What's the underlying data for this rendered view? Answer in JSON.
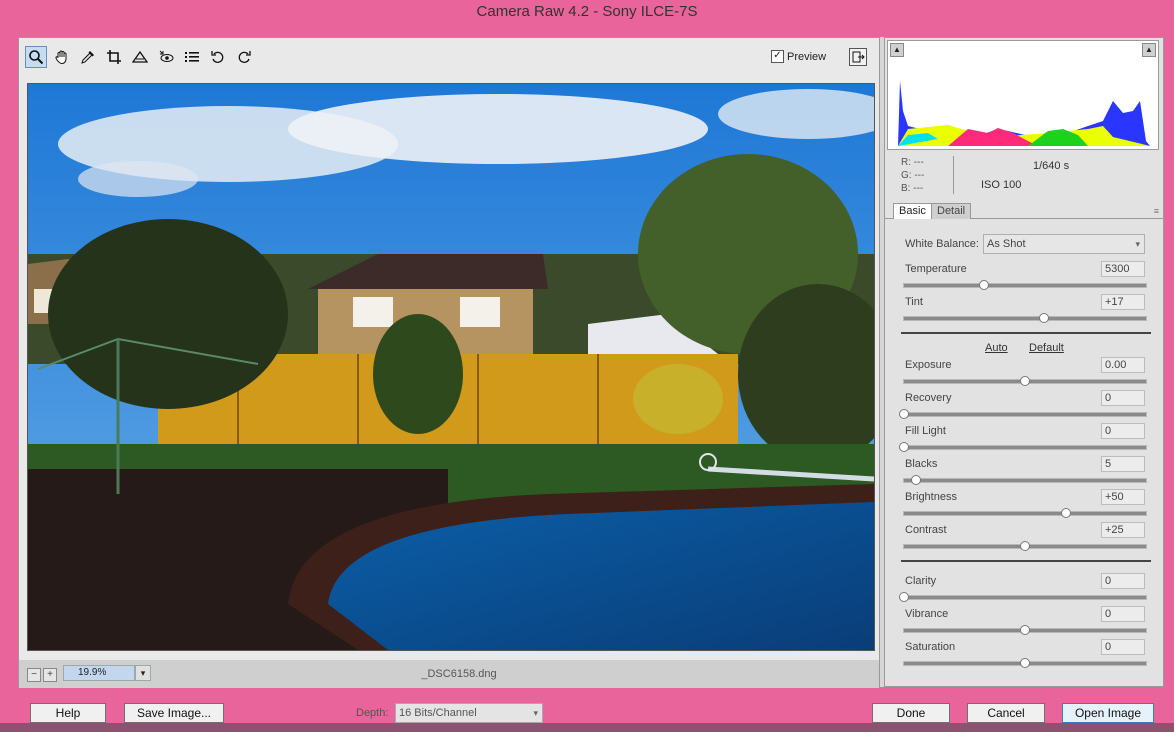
{
  "window": {
    "title": "Camera Raw 4.2  -  Sony ILCE-7S"
  },
  "toolbar": {
    "tools": [
      {
        "icon": "zoom-icon"
      },
      {
        "icon": "hand-icon"
      },
      {
        "icon": "eyedropper-icon"
      },
      {
        "icon": "crop-icon"
      },
      {
        "icon": "straighten-icon"
      },
      {
        "icon": "red-eye-icon"
      },
      {
        "icon": "preferences-icon"
      },
      {
        "icon": "rotate-left-icon"
      },
      {
        "icon": "rotate-right-icon"
      }
    ],
    "preview_label": "Preview",
    "preview_checked": true
  },
  "status": {
    "zoom_value": "19.9%",
    "filename": "_DSC6158.dng"
  },
  "info": {
    "r_label": "R:",
    "g_label": "G:",
    "b_label": "B:",
    "r_value": "---",
    "g_value": "---",
    "b_value": "---",
    "shutter": "1/640 s",
    "iso": "ISO 100"
  },
  "tabs": {
    "basic": "Basic",
    "detail": "Detail"
  },
  "basic": {
    "wb_label": "White Balance:",
    "wb_value": "As Shot",
    "temperature": {
      "label": "Temperature",
      "value": "5300",
      "level": 0.33
    },
    "tint": {
      "label": "Tint",
      "value": "+17",
      "level": 0.58
    },
    "auto": "Auto",
    "default": "Default",
    "exposure": {
      "label": "Exposure",
      "value": "0.00",
      "level": 0.5
    },
    "recovery": {
      "label": "Recovery",
      "value": "0",
      "level": 0.0
    },
    "fill_light": {
      "label": "Fill Light",
      "value": "0",
      "level": 0.0
    },
    "blacks": {
      "label": "Blacks",
      "value": "5",
      "level": 0.05
    },
    "brightness": {
      "label": "Brightness",
      "value": "+50",
      "level": 0.67
    },
    "contrast": {
      "label": "Contrast",
      "value": "+25",
      "level": 0.5
    },
    "clarity": {
      "label": "Clarity",
      "value": "0",
      "level": 0.0
    },
    "vibrance": {
      "label": "Vibrance",
      "value": "0",
      "level": 0.5
    },
    "saturation": {
      "label": "Saturation",
      "value": "0",
      "level": 0.5
    }
  },
  "buttons": {
    "help": "Help",
    "save": "Save Image...",
    "done": "Done",
    "cancel": "Cancel",
    "open": "Open Image"
  },
  "depth": {
    "label": "Depth:",
    "value": "16 Bits/Channel"
  },
  "colors": {
    "window_border": "#e8649a",
    "accent": "#3c7fb1"
  }
}
